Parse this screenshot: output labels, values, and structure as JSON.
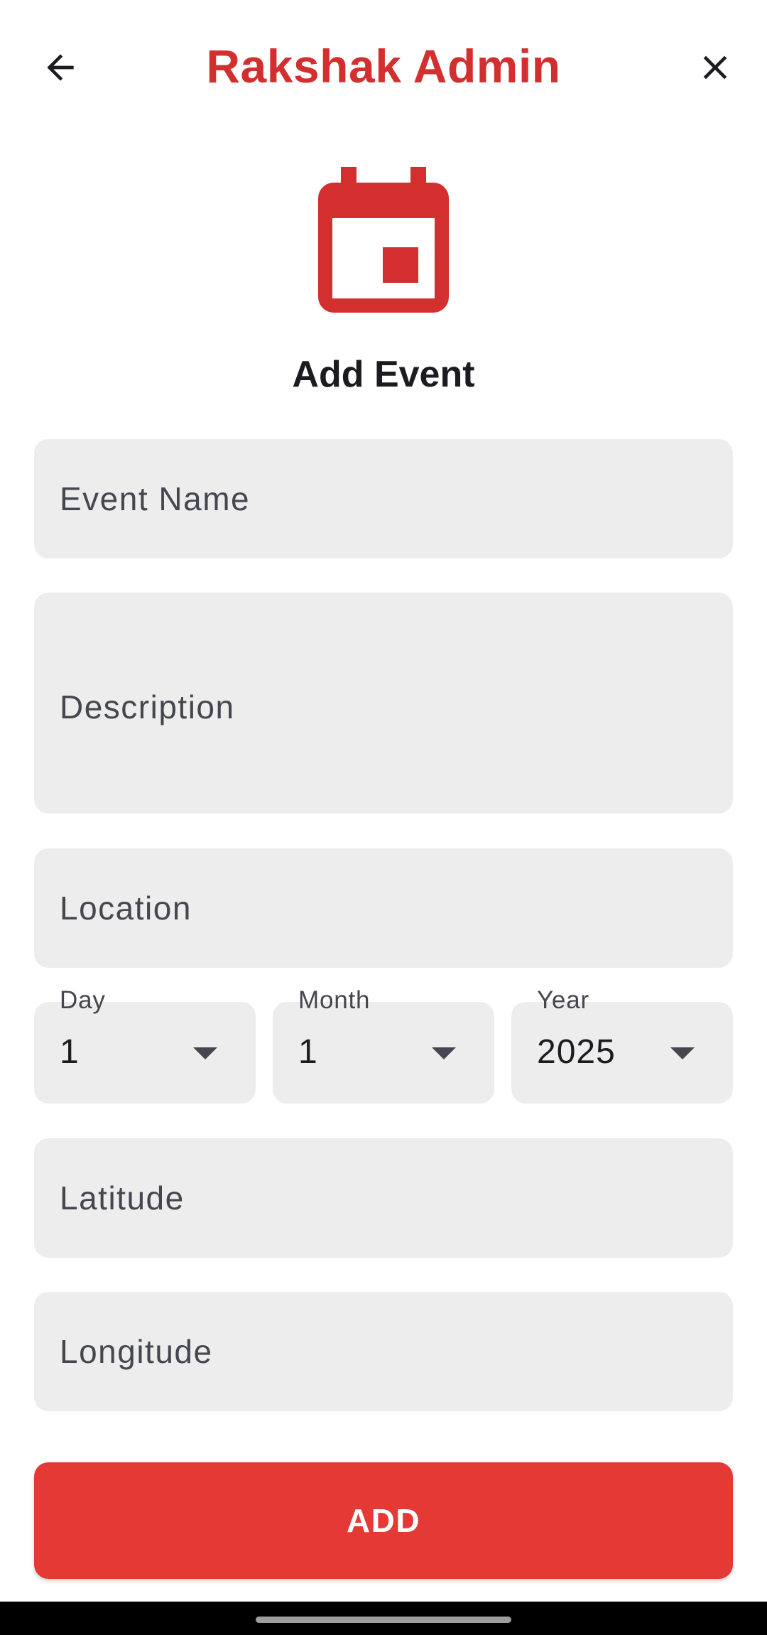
{
  "app_bar": {
    "title": "Rakshak Admin",
    "back_icon": "arrow-back-icon",
    "close_icon": "close-icon"
  },
  "form": {
    "hero_icon": "calendar-event-icon",
    "title": "Add Event",
    "event_name": {
      "value": "",
      "placeholder": "Event Name"
    },
    "description": {
      "value": "",
      "placeholder": "Description"
    },
    "location": {
      "value": "",
      "placeholder": "Location"
    },
    "date": {
      "day": {
        "label": "Day",
        "value": "1"
      },
      "month": {
        "label": "Month",
        "value": "1"
      },
      "year": {
        "label": "Year",
        "value": "2025"
      }
    },
    "latitude": {
      "value": "",
      "placeholder": "Latitude"
    },
    "longitude": {
      "value": "",
      "placeholder": "Longitude"
    },
    "submit_label": "ADD"
  },
  "colors": {
    "brand": "#d32f2f",
    "button": "#e53935",
    "field_bg": "#ededed"
  }
}
